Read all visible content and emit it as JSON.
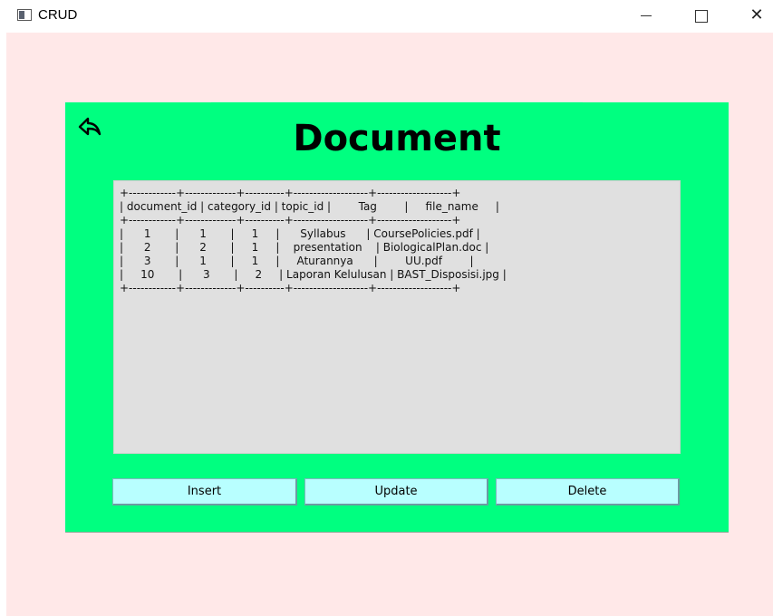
{
  "window": {
    "title": "CRUD",
    "minimize_label": "",
    "maximize_label": "",
    "close_label": "✕"
  },
  "page": {
    "title": "Document",
    "back_icon": "back-arrow-icon"
  },
  "colors": {
    "background": "#ffe8e8",
    "panel": "#00ff80",
    "textarea": "#e0e0e0",
    "button": "#b8ffff"
  },
  "table_text": {
    "lines": [
      "+------------+-------------+----------+-------------------+-------------------+",
      "| document_id | category_id | topic_id |        Tag        |     file_name     |",
      "+------------+-------------+----------+-------------------+-------------------+",
      "|      1       |      1       |     1     |      Syllabus      | CoursePolicies.pdf |",
      "|      2       |      2       |     1     |    presentation    | BiologicalPlan.doc |",
      "|      3       |      1       |     1     |     Aturannya      |        UU.pdf        |",
      "|     10       |      3       |     2     | Laporan Kelulusan | BAST_Disposisi.jpg |",
      "+------------+-------------+----------+-------------------+-------------------+"
    ]
  },
  "buttons": {
    "insert": "Insert",
    "update": "Update",
    "delete": "Delete"
  }
}
